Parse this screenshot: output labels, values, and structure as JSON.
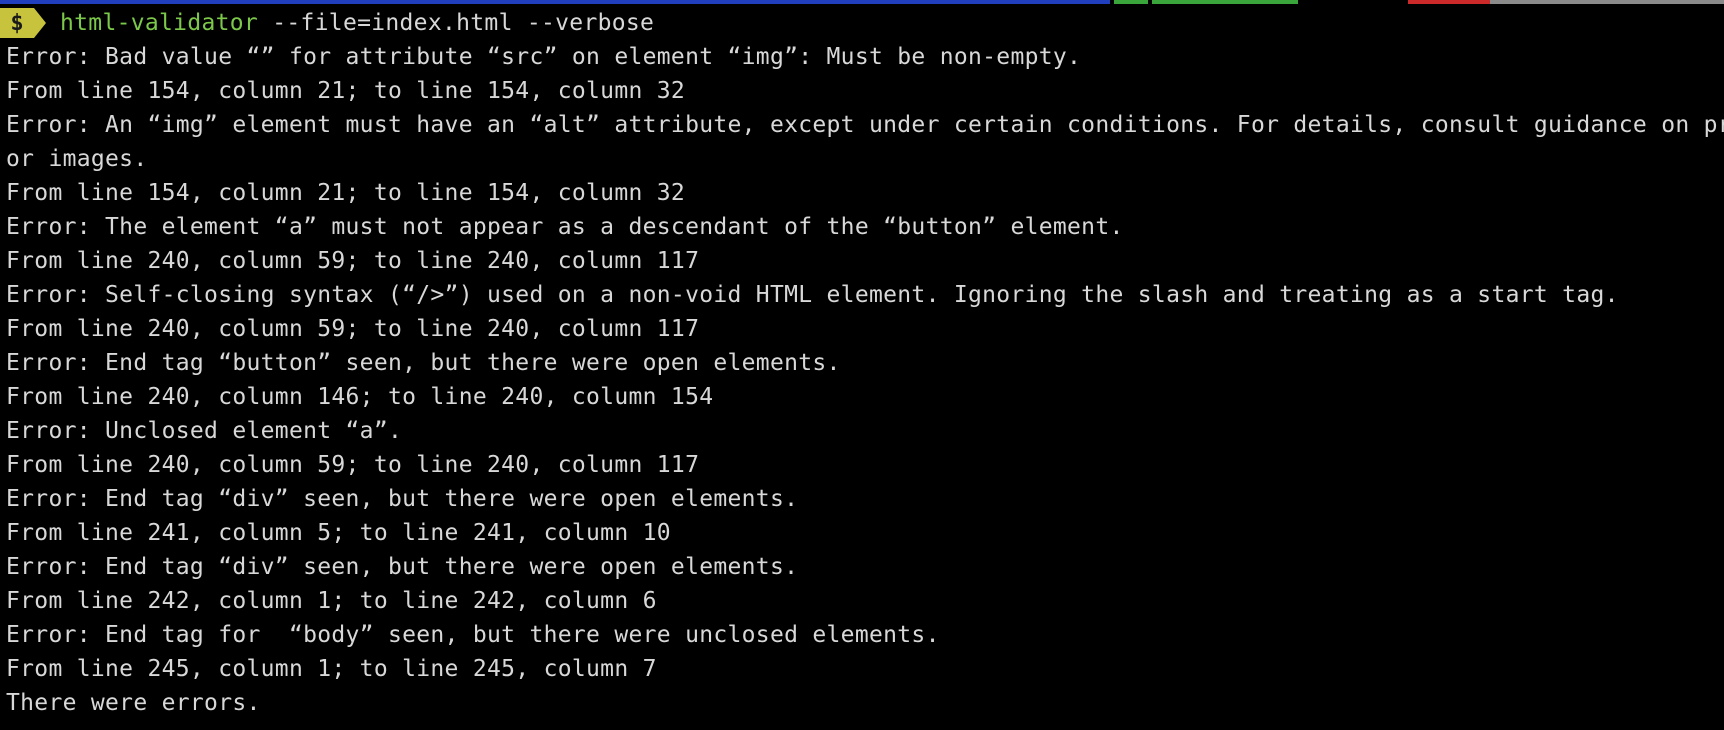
{
  "colors": {
    "background": "#000000",
    "text": "#d8d8d8",
    "command": "#7cc84a",
    "prompt_badge": "#c7c33c",
    "status_segments": [
      "#1f3fbf",
      "#3aa53a",
      "#cc2a2a",
      "#8a8a8a"
    ]
  },
  "prompt": {
    "symbol": "$",
    "command": "html-validator",
    "args": " --file=index.html --verbose"
  },
  "output_lines": [
    "Error: Bad value “” for attribute “src” on element “img”: Must be non-empty.",
    "From line 154, column 21; to line 154, column 32",
    "Error: An “img” element must have an “alt” attribute, except under certain conditions. For details, consult guidance on pro",
    "or images.",
    "From line 154, column 21; to line 154, column 32",
    "Error: The element “a” must not appear as a descendant of the “button” element.",
    "From line 240, column 59; to line 240, column 117",
    "Error: Self-closing syntax (“/>”) used on a non-void HTML element. Ignoring the slash and treating as a start tag.",
    "From line 240, column 59; to line 240, column 117",
    "Error: End tag “button” seen, but there were open elements.",
    "From line 240, column 146; to line 240, column 154",
    "Error: Unclosed element “a”.",
    "From line 240, column 59; to line 240, column 117",
    "Error: End tag “div” seen, but there were open elements.",
    "From line 241, column 5; to line 241, column 10",
    "Error: End tag “div” seen, but there were open elements.",
    "From line 242, column 1; to line 242, column 6",
    "Error: End tag for  “body” seen, but there were unclosed elements.",
    "From line 245, column 1; to line 245, column 7",
    "There were errors."
  ]
}
